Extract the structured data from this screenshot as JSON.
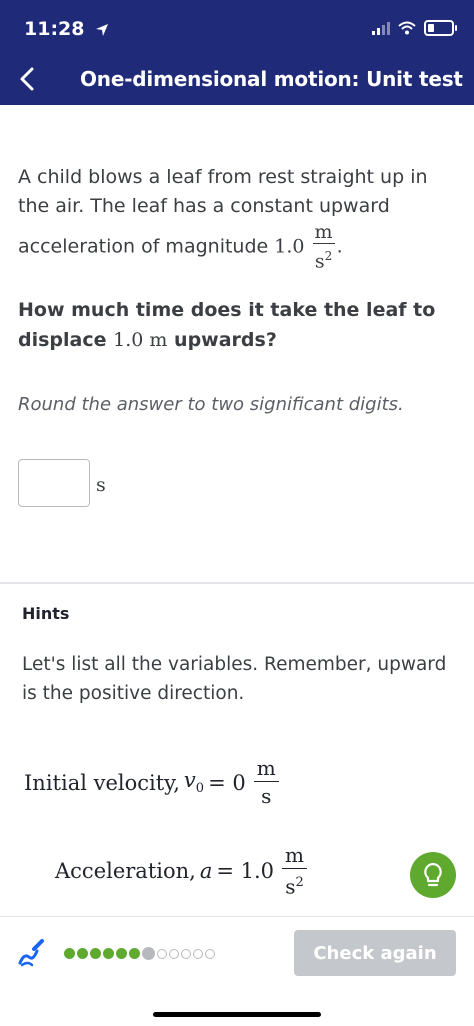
{
  "status": {
    "time": "11:28",
    "location_icon": "location-arrow-icon",
    "signal_icon": "signal-icon",
    "wifi_icon": "wifi-icon",
    "battery_icon": "battery-icon"
  },
  "header": {
    "title": "One-dimensional motion: Unit test",
    "back_icon": "chevron-left-icon",
    "background": "#1f2a78"
  },
  "problem": {
    "text_before": "A child blows a leaf from rest straight up in the air. The leaf has a constant upward acceleration of magnitude",
    "value": "1.0",
    "unit_num": "m",
    "unit_den": "s",
    "unit_den_exp": "2",
    "text_after": ".",
    "question_before": "How much time does it take the leaf to displace",
    "question_value": "1.0 m",
    "question_after": "upwards?",
    "instruction": "Round the answer to two significant digits.",
    "answer_value": "",
    "answer_unit": "s"
  },
  "hints": {
    "label": "Hints",
    "text": "Let's list all the variables. Remember, upward is the positive direction.",
    "line1_label": "Initial velocity,",
    "line1_var": "v",
    "line1_sub": "0",
    "line1_eq": "= 0",
    "line1_num": "m",
    "line1_den": "s",
    "line2_label": "Acceleration,",
    "line2_var": "a",
    "line2_eq": "= 1.0",
    "line2_num": "m",
    "line2_den": "s",
    "line2_den_exp": "2",
    "hint_button_icon": "lightbulb-icon"
  },
  "footer": {
    "scratchpad_icon": "scratchpad-pencil-icon",
    "progress": {
      "completed": 6,
      "current": 7,
      "total": 12
    },
    "check_label": "Check again",
    "accent": "#5fa92e"
  }
}
